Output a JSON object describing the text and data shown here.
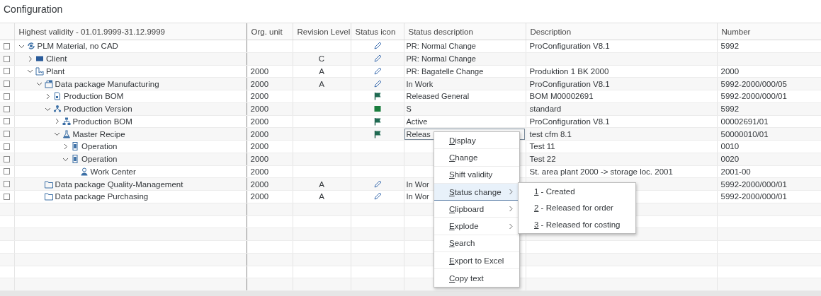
{
  "title": "Configuration",
  "table": {
    "columns": [
      "Highest validity - 01.01.9999-31.12.9999",
      "Org. unit",
      "Revision Level",
      "Status icon",
      "Status description",
      "Description",
      "Number"
    ],
    "rows": [
      {
        "label": "PLM Material, no CAD",
        "kind": "material",
        "checked": false,
        "expanded": true,
        "status_icon": {
          "kind": "pencil"
        },
        "status": "PR: Normal Change",
        "focused": false,
        "description": "ProConfiguration V8.1",
        "number": "5992",
        "children": [
          {
            "label": "Client",
            "kind": "client",
            "checked": false,
            "expanded": false,
            "revision": "C",
            "status_icon": {
              "kind": "pencil"
            },
            "status": "PR: Normal Change",
            "focused": false
          },
          {
            "label": "Plant",
            "kind": "plant",
            "checked": false,
            "expanded": true,
            "org_unit": "2000",
            "revision": "A",
            "status_icon": {
              "kind": "pencil"
            },
            "status": "PR: Bagatelle Change",
            "focused": false,
            "description": "Produktion 1 BK 2000",
            "number": "2000",
            "children": [
              {
                "label": "Data package Manufacturing",
                "kind": "package",
                "checked": false,
                "expanded": true,
                "org_unit": "2000",
                "revision": "A",
                "status_icon": {
                  "kind": "pencil"
                },
                "status": "In Work",
                "focused": false,
                "description": "ProConfiguration V8.1",
                "number": "5992-2000/000/05",
                "children": [
                  {
                    "label": "Production BOM",
                    "kind": "document",
                    "checked": false,
                    "expanded": false,
                    "org_unit": "2000",
                    "status_icon": {
                      "kind": "flag"
                    },
                    "status": "Released General",
                    "focused": false,
                    "description": "BOM M00002691",
                    "number": "5992-2000/000/01"
                  },
                  {
                    "label": "Production Version",
                    "kind": "version",
                    "checked": false,
                    "expanded": true,
                    "org_unit": "2000",
                    "status_icon": {
                      "kind": "square"
                    },
                    "status": "S",
                    "focused": false,
                    "description": "standard",
                    "number": "5992",
                    "children": [
                      {
                        "label": "Production BOM",
                        "kind": "hierarchy",
                        "checked": false,
                        "expanded": false,
                        "org_unit": "2000",
                        "status_icon": {
                          "kind": "flag"
                        },
                        "status": "Active",
                        "focused": false,
                        "description": "ProConfiguration V8.1",
                        "number": "00002691/01"
                      },
                      {
                        "label": "Master Recipe",
                        "kind": "flask",
                        "checked": false,
                        "expanded": true,
                        "org_unit": "2000",
                        "status_icon": {
                          "kind": "flag"
                        },
                        "status": "Releas",
                        "focused": true,
                        "description": "test cfm 8.1",
                        "number": "50000010/01",
                        "children": [
                          {
                            "label": "Operation",
                            "kind": "operation",
                            "checked": false,
                            "expanded": false,
                            "org_unit": "2000",
                            "description": "Test 11",
                            "number": "0010"
                          },
                          {
                            "label": "Operation",
                            "kind": "operation",
                            "checked": false,
                            "expanded": true,
                            "org_unit": "2000",
                            "description": "Test 22",
                            "number": "0020",
                            "children": [
                              {
                                "label": "Work Center",
                                "kind": "person",
                                "checked": false,
                                "org_unit": "2000",
                                "description": "St. area plant 2000 -> storage loc. 2001",
                                "number": "2001-00"
                              }
                            ]
                          }
                        ]
                      }
                    ]
                  }
                ]
              },
              {
                "label": "Data package Quality-Management",
                "kind": "folder",
                "checked": false,
                "org_unit": "2000",
                "revision": "A",
                "status_icon": {
                  "kind": "pencil"
                },
                "status": "In Wor",
                "focused": false,
                "number": "5992-2000/000/01"
              },
              {
                "label": "Data package Purchasing",
                "kind": "folder",
                "checked": false,
                "org_unit": "2000",
                "revision": "A",
                "status_icon": {
                  "kind": "pencil"
                },
                "status": "In Wor",
                "focused": false,
                "number": "5992-2000/000/01"
              }
            ]
          }
        ]
      }
    ]
  },
  "context_menu": {
    "items": [
      {
        "label": "Display",
        "has_submenu": false,
        "selected": false
      },
      {
        "label": "Change",
        "has_submenu": false,
        "selected": false
      },
      {
        "label": "Shift validity",
        "has_submenu": false,
        "selected": false
      },
      {
        "label": "Status change",
        "has_submenu": true,
        "selected": true
      },
      {
        "label": "Clipboard",
        "has_submenu": true,
        "selected": false
      },
      {
        "label": "Explode",
        "has_submenu": true,
        "selected": false
      },
      {
        "label": "Search",
        "has_submenu": false,
        "selected": false
      },
      {
        "label": "Export to Excel",
        "has_submenu": false,
        "selected": false
      },
      {
        "label": "Copy text",
        "has_submenu": false,
        "selected": false
      }
    ]
  },
  "status_menu": {
    "items": [
      {
        "label": "1 - Created",
        "selected": false
      },
      {
        "label": "2 - Released for order",
        "selected": false
      },
      {
        "label": "3 - Released for costing",
        "selected": false
      }
    ]
  }
}
